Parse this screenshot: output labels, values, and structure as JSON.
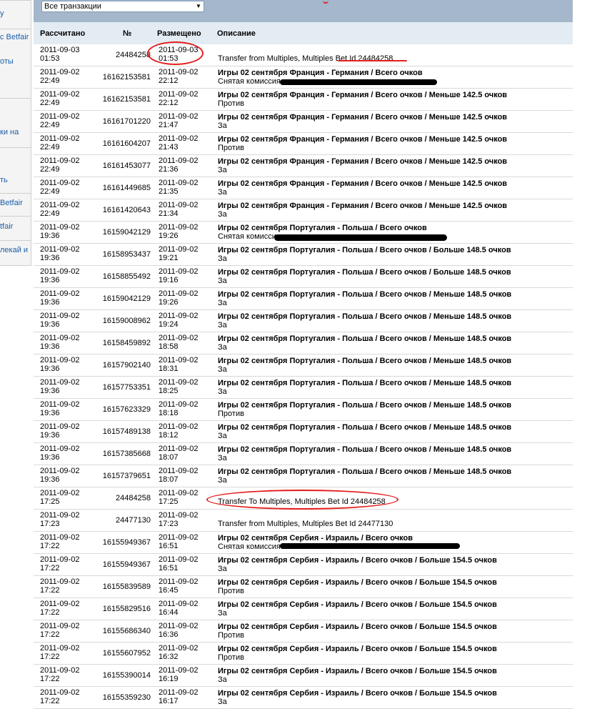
{
  "left_nav": {
    "items": [
      "у",
      "с Betfair",
      "оты",
      "ки на",
      "ть",
      "Betfair",
      "tfair",
      "лекай и"
    ]
  },
  "filter": {
    "selected": "Все транзакции"
  },
  "columns": {
    "settled": "Рассчитано",
    "number": "№",
    "placed": "Размещено",
    "description": "Описание"
  },
  "rows": [
    {
      "settled_date": "2011-09-03",
      "settled_time": "01:53",
      "number": "24484258",
      "placed_date": "2011-09-03",
      "placed_time": "01:53",
      "line1": "",
      "line2": "Transfer from Multiples, Multiples Bet Id 24484258",
      "plain": true
    },
    {
      "settled_date": "2011-09-02",
      "settled_time": "22:49",
      "number": "16162153581",
      "placed_date": "2011-09-02",
      "placed_time": "22:12",
      "line1": "Игры 02 сентября Франция - Германия / Всего очков",
      "line2": "Снятая комиссия",
      "plain": false
    },
    {
      "settled_date": "2011-09-02",
      "settled_time": "22:49",
      "number": "16162153581",
      "placed_date": "2011-09-02",
      "placed_time": "22:12",
      "line1": "Игры 02 сентября Франция - Германия / Всего очков / Меньше 142.5 очков",
      "line2": "Против",
      "plain": false
    },
    {
      "settled_date": "2011-09-02",
      "settled_time": "22:49",
      "number": "16161701220",
      "placed_date": "2011-09-02",
      "placed_time": "21:47",
      "line1": "Игры 02 сентября Франция - Германия / Всего очков / Меньше 142.5 очков",
      "line2": "За",
      "plain": false
    },
    {
      "settled_date": "2011-09-02",
      "settled_time": "22:49",
      "number": "16161604207",
      "placed_date": "2011-09-02",
      "placed_time": "21:43",
      "line1": "Игры 02 сентября Франция - Германия / Всего очков / Меньше 142.5 очков",
      "line2": "Против",
      "plain": false
    },
    {
      "settled_date": "2011-09-02",
      "settled_time": "22:49",
      "number": "16161453077",
      "placed_date": "2011-09-02",
      "placed_time": "21:36",
      "line1": "Игры 02 сентября Франция - Германия / Всего очков / Меньше 142.5 очков",
      "line2": "За",
      "plain": false
    },
    {
      "settled_date": "2011-09-02",
      "settled_time": "22:49",
      "number": "16161449685",
      "placed_date": "2011-09-02",
      "placed_time": "21:35",
      "line1": "Игры 02 сентября Франция - Германия / Всего очков / Меньше 142.5 очков",
      "line2": "За",
      "plain": false
    },
    {
      "settled_date": "2011-09-02",
      "settled_time": "22:49",
      "number": "16161420643",
      "placed_date": "2011-09-02",
      "placed_time": "21:34",
      "line1": "Игры 02 сентября Франция - Германия / Всего очков / Меньше 142.5 очков",
      "line2": "За",
      "plain": false
    },
    {
      "settled_date": "2011-09-02",
      "settled_time": "19:36",
      "number": "16159042129",
      "placed_date": "2011-09-02",
      "placed_time": "19:26",
      "line1": "Игры 02 сентября Португалия - Польша / Всего очков",
      "line2": "Снятая комисси",
      "plain": false
    },
    {
      "settled_date": "2011-09-02",
      "settled_time": "19:36",
      "number": "16158953437",
      "placed_date": "2011-09-02",
      "placed_time": "19:21",
      "line1": "Игры 02 сентября Португалия - Польша / Всего очков / Больше 148.5 очков",
      "line2": "За",
      "plain": false
    },
    {
      "settled_date": "2011-09-02",
      "settled_time": "19:36",
      "number": "16158855492",
      "placed_date": "2011-09-02",
      "placed_time": "19:16",
      "line1": "Игры 02 сентября Португалия - Польша / Всего очков / Больше 148.5 очков",
      "line2": "За",
      "plain": false
    },
    {
      "settled_date": "2011-09-02",
      "settled_time": "19:36",
      "number": "16159042129",
      "placed_date": "2011-09-02",
      "placed_time": "19:26",
      "line1": "Игры 02 сентября Португалия - Польша / Всего очков / Меньше 148.5 очков",
      "line2": "За",
      "plain": false
    },
    {
      "settled_date": "2011-09-02",
      "settled_time": "19:36",
      "number": "16159008962",
      "placed_date": "2011-09-02",
      "placed_time": "19:24",
      "line1": "Игры 02 сентября Португалия - Польша / Всего очков / Меньше 148.5 очков",
      "line2": "За",
      "plain": false
    },
    {
      "settled_date": "2011-09-02",
      "settled_time": "19:36",
      "number": "16158459892",
      "placed_date": "2011-09-02",
      "placed_time": "18:58",
      "line1": "Игры 02 сентября Португалия - Польша / Всего очков / Меньше 148.5 очков",
      "line2": "За",
      "plain": false
    },
    {
      "settled_date": "2011-09-02",
      "settled_time": "19:36",
      "number": "16157902140",
      "placed_date": "2011-09-02",
      "placed_time": "18:31",
      "line1": "Игры 02 сентября Португалия - Польша / Всего очков / Меньше 148.5 очков",
      "line2": "За",
      "plain": false
    },
    {
      "settled_date": "2011-09-02",
      "settled_time": "19:36",
      "number": "16157753351",
      "placed_date": "2011-09-02",
      "placed_time": "18:25",
      "line1": "Игры 02 сентября Португалия - Польша / Всего очков / Меньше 148.5 очков",
      "line2": "За",
      "plain": false
    },
    {
      "settled_date": "2011-09-02",
      "settled_time": "19:36",
      "number": "16157623329",
      "placed_date": "2011-09-02",
      "placed_time": "18:18",
      "line1": "Игры 02 сентября Португалия - Польша / Всего очков / Меньше 148.5 очков",
      "line2": "Против",
      "plain": false
    },
    {
      "settled_date": "2011-09-02",
      "settled_time": "19:36",
      "number": "16157489138",
      "placed_date": "2011-09-02",
      "placed_time": "18:12",
      "line1": "Игры 02 сентября Португалия - Польша / Всего очков / Меньше 148.5 очков",
      "line2": "За",
      "plain": false
    },
    {
      "settled_date": "2011-09-02",
      "settled_time": "19:36",
      "number": "16157385668",
      "placed_date": "2011-09-02",
      "placed_time": "18:07",
      "line1": "Игры 02 сентября Португалия - Польша / Всего очков / Меньше 148.5 очков",
      "line2": "За",
      "plain": false
    },
    {
      "settled_date": "2011-09-02",
      "settled_time": "19:36",
      "number": "16157379651",
      "placed_date": "2011-09-02",
      "placed_time": "18:07",
      "line1": "Игры 02 сентября Португалия - Польша / Всего очков / Меньше 148.5 очков",
      "line2": "За",
      "plain": false
    },
    {
      "settled_date": "2011-09-02",
      "settled_time": "17:25",
      "number": "24484258",
      "placed_date": "2011-09-02",
      "placed_time": "17:25",
      "line1": "",
      "line2": "Transfer To Multiples, Multiples Bet Id 24484258",
      "plain": true
    },
    {
      "settled_date": "2011-09-02",
      "settled_time": "17:23",
      "number": "24477130",
      "placed_date": "2011-09-02",
      "placed_time": "17:23",
      "line1": "",
      "line2": "Transfer from Multiples, Multiples Bet Id 24477130",
      "plain": true
    },
    {
      "settled_date": "2011-09-02",
      "settled_time": "17:22",
      "number": "16155949367",
      "placed_date": "2011-09-02",
      "placed_time": "16:51",
      "line1": "Игры 02 сентября Сербия - Израиль / Всего очков",
      "line2": "Снятая комиссия",
      "plain": false
    },
    {
      "settled_date": "2011-09-02",
      "settled_time": "17:22",
      "number": "16155949367",
      "placed_date": "2011-09-02",
      "placed_time": "16:51",
      "line1": "Игры 02 сентября Сербия - Израиль / Всего очков / Больше 154.5 очков",
      "line2": "За",
      "plain": false
    },
    {
      "settled_date": "2011-09-02",
      "settled_time": "17:22",
      "number": "16155839589",
      "placed_date": "2011-09-02",
      "placed_time": "16:45",
      "line1": "Игры 02 сентября Сербия - Израиль / Всего очков / Больше 154.5 очков",
      "line2": "Против",
      "plain": false
    },
    {
      "settled_date": "2011-09-02",
      "settled_time": "17:22",
      "number": "16155829516",
      "placed_date": "2011-09-02",
      "placed_time": "16:44",
      "line1": "Игры 02 сентября Сербия - Израиль / Всего очков / Больше 154.5 очков",
      "line2": "За",
      "plain": false
    },
    {
      "settled_date": "2011-09-02",
      "settled_time": "17:22",
      "number": "16155686340",
      "placed_date": "2011-09-02",
      "placed_time": "16:36",
      "line1": "Игры 02 сентября Сербия - Израиль / Всего очков / Больше 154.5 очков",
      "line2": "Против",
      "plain": false
    },
    {
      "settled_date": "2011-09-02",
      "settled_time": "17:22",
      "number": "16155607952",
      "placed_date": "2011-09-02",
      "placed_time": "16:32",
      "line1": "Игры 02 сентября Сербия - Израиль / Всего очков / Больше 154.5 очков",
      "line2": "Против",
      "plain": false
    },
    {
      "settled_date": "2011-09-02",
      "settled_time": "17:22",
      "number": "16155390014",
      "placed_date": "2011-09-02",
      "placed_time": "16:19",
      "line1": "Игры 02 сентября Сербия - Израиль / Всего очков / Больше 154.5 очков",
      "line2": "За",
      "plain": false
    },
    {
      "settled_date": "2011-09-02",
      "settled_time": "17:22",
      "number": "16155359230",
      "placed_date": "2011-09-02",
      "placed_time": "16:17",
      "line1": "Игры 02 сентября Сербия - Израиль / Всего очков / Больше 154.5 очков",
      "line2": "За",
      "plain": false
    }
  ],
  "annotation_color": "#e51e1e"
}
